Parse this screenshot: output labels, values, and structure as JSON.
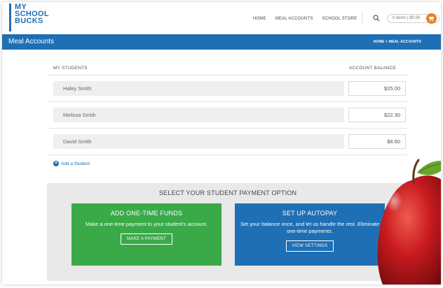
{
  "header": {
    "logo_line1": "MY",
    "logo_line2": "SCHOOL",
    "logo_line3": "BUCKS",
    "nav": [
      "HOME",
      "MEAL ACCOUNTS",
      "SCHOOL STORE"
    ],
    "cart_text": "0 items | $0.00",
    "search_icon": "search-icon",
    "cart_icon": "cart-icon"
  },
  "bar": {
    "title": "Meal Accounts",
    "breadcrumb": "HOME > MEAL ACCOUNTS"
  },
  "students": {
    "col_students": "MY STUDENTS",
    "col_balance": "ACCOUNT BALANCE",
    "rows": [
      {
        "name": "Haley Smith",
        "balance": "$25.00"
      },
      {
        "name": "Melissa Smith",
        "balance": "$22.30"
      },
      {
        "name": "David Smith",
        "balance": "$8.60"
      }
    ],
    "add_label": "Add a Student"
  },
  "payment": {
    "title": "SELECT YOUR STUDENT PAYMENT OPTION",
    "one_time": {
      "title": "ADD ONE-TIME FUNDS",
      "desc": "Make a one-time payment to your student's account.",
      "button": "MAKE A PAYMENT"
    },
    "autopay": {
      "title": "SET UP AUTOPAY",
      "desc": "Set your balance once, and let us handle the rest. Eliminate one-time payments.",
      "button": "VIEW SETTINGS"
    }
  },
  "colors": {
    "brand_blue": "#1f6fb5",
    "green": "#3aaa49",
    "cart_orange": "#e8811c"
  }
}
